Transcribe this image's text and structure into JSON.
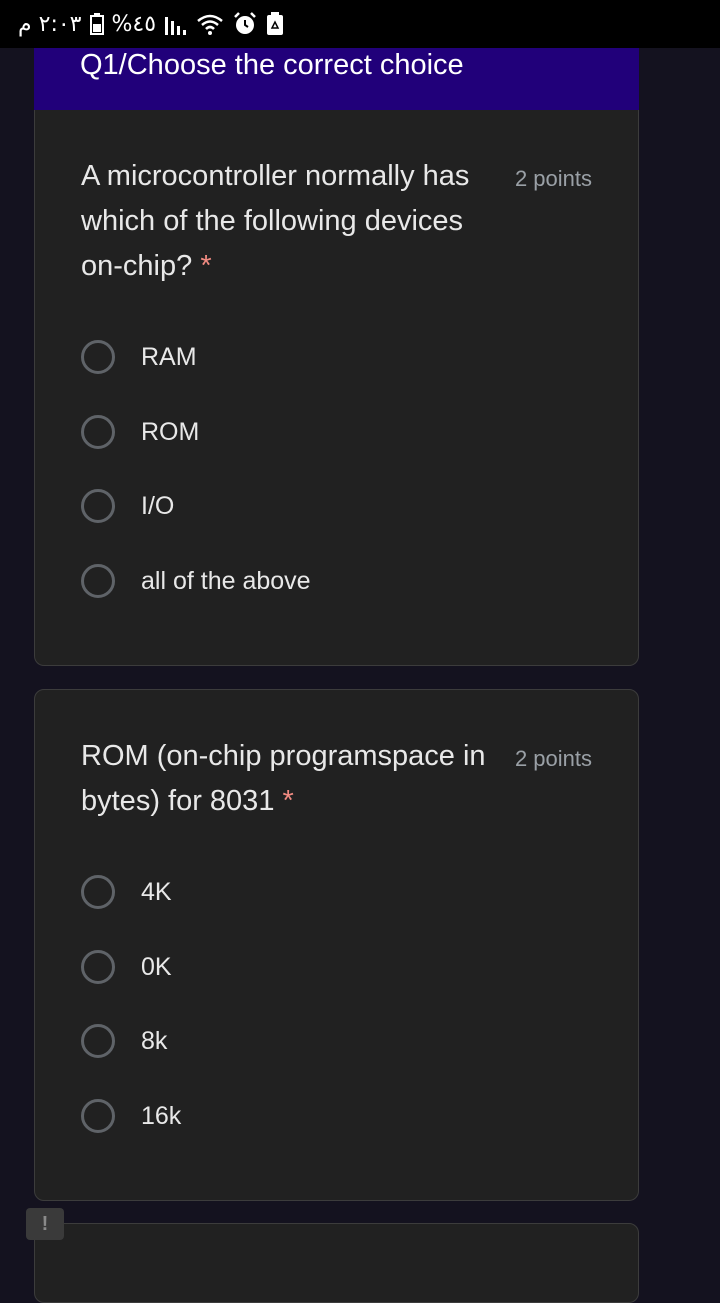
{
  "status_bar": {
    "time": "٢:٠٣ م",
    "battery": "%٤٥",
    "icons": [
      "battery-icon",
      "signal-icon",
      "wifi-icon",
      "alarm-icon",
      "recycle-icon"
    ]
  },
  "header": {
    "title": "Q1/Choose the correct choice"
  },
  "questions": [
    {
      "text": "A microcontroller normally has which of the following devices on-chip?",
      "required_mark": "*",
      "points": "2 points",
      "options": [
        "RAM",
        "ROM",
        "I/O",
        "all of the above"
      ]
    },
    {
      "text": "ROM (on-chip programspace in bytes) for 8031",
      "required_mark": "*",
      "points": "2 points",
      "options": [
        "4K",
        "0K",
        "8k",
        "16k"
      ]
    }
  ],
  "colors": {
    "header_bg": "#21007a",
    "card_bg": "#212121",
    "page_bg": "#14121f",
    "required": "#f28b82"
  }
}
